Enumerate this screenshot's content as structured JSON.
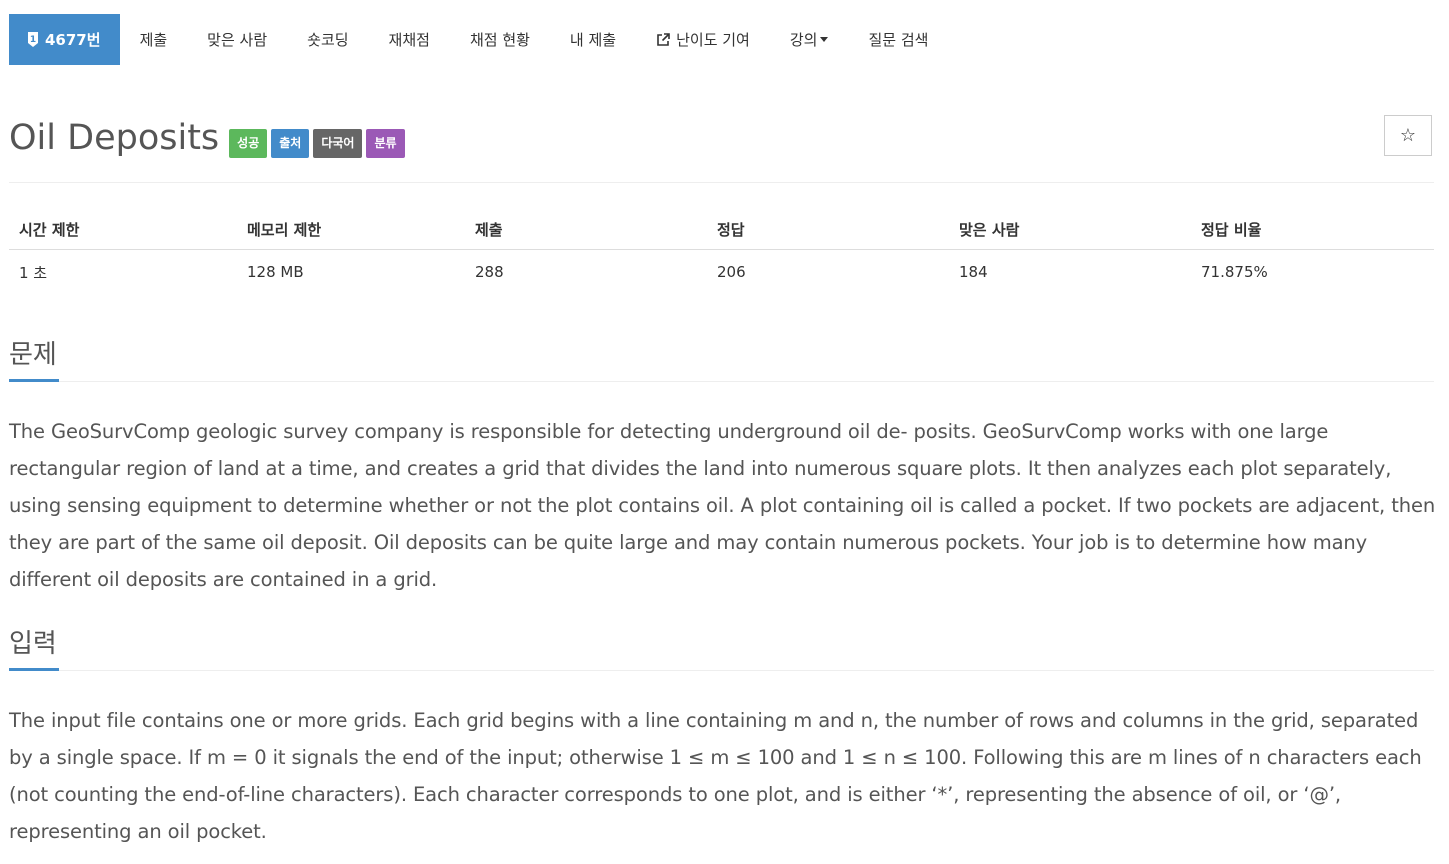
{
  "nav": {
    "problem_number": "4677번",
    "items": [
      "제출",
      "맞은 사람",
      "숏코딩",
      "재채점",
      "채점 현황",
      "내 제출",
      "난이도 기여",
      "강의",
      "질문 검색"
    ]
  },
  "title": "Oil Deposits",
  "labels": [
    {
      "text": "성공",
      "color": "#5cb85c"
    },
    {
      "text": "출처",
      "color": "#428bca"
    },
    {
      "text": "다국어",
      "color": "#666666"
    },
    {
      "text": "분류",
      "color": "#9b59b6"
    }
  ],
  "star": "☆",
  "stats": {
    "headers": [
      "시간 제한",
      "메모리 제한",
      "제출",
      "정답",
      "맞은 사람",
      "정답 비율"
    ],
    "values": [
      "1 초",
      "128 MB",
      "288",
      "206",
      "184",
      "71.875%"
    ]
  },
  "sections": {
    "problem": {
      "title": "문제",
      "text": "The GeoSurvComp geologic survey company is responsible for detecting underground oil de- posits. GeoSurvComp works with one large rectangular region of land at a time, and creates a grid that divides the land into numerous square plots. It then analyzes each plot separately, using sensing equipment to determine whether or not the plot contains oil. A plot containing oil is called a pocket. If two pockets are adjacent, then they are part of the same oil deposit. Oil deposits can be quite large and may contain numerous pockets. Your job is to determine how many different oil deposits are contained in a grid."
    },
    "input": {
      "title": "입력",
      "text": "The input file contains one or more grids. Each grid begins with a line containing m and n, the number of rows and columns in the grid, separated by a single space. If m = 0 it signals the end of the input; otherwise 1 ≤ m ≤ 100 and 1 ≤ n ≤ 100. Following this are m lines of n characters each (not counting the end-of-line characters). Each character corresponds to one plot, and is either ‘*’, representing the absence of oil, or ‘@’, representing an oil pocket."
    }
  }
}
